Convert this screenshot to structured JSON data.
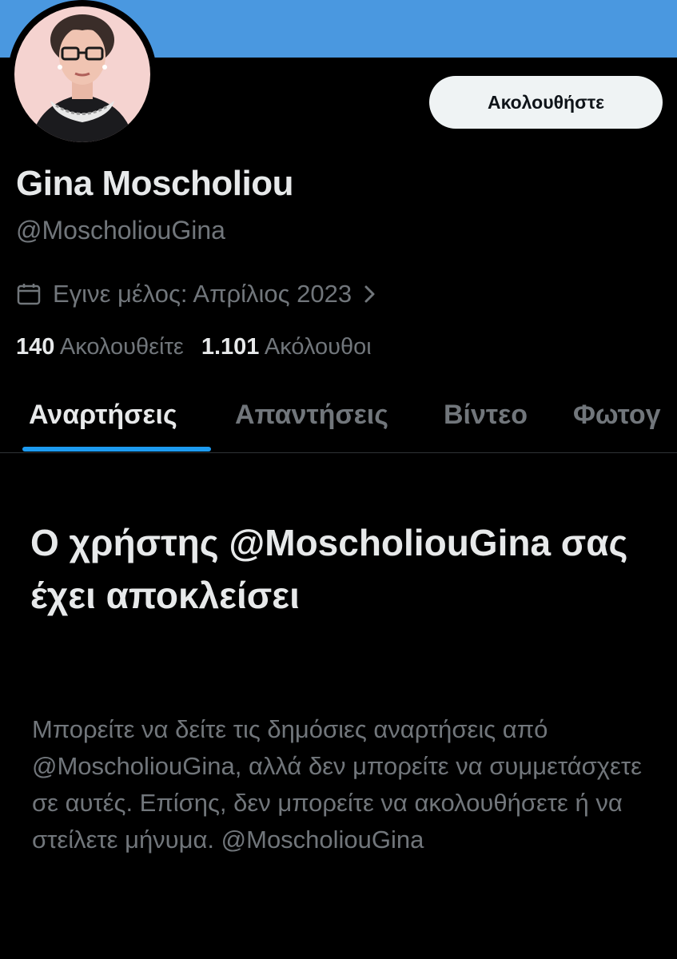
{
  "profile": {
    "display_name": "Gina Moscholiou",
    "handle": "@MoscholiouGina",
    "joined": "Εγινε μέλος: Απρίλιος 2023",
    "following_count": "140",
    "following_label": "Ακολουθείτε",
    "followers_count": "1.101",
    "followers_label": "Ακόλουθοι"
  },
  "actions": {
    "follow_label": "Ακολουθήστε"
  },
  "tabs": [
    {
      "label": "Αναρτήσεις",
      "active": true
    },
    {
      "label": "Απαντήσεις",
      "active": false
    },
    {
      "label": "Βίντεο",
      "active": false
    },
    {
      "label": "Φωτογ",
      "active": false
    }
  ],
  "blocked": {
    "title": "Ο χρήστης @MoscholiouGina σας έχει αποκλείσει",
    "description": "Μπορείτε να δείτε τις δημόσιες αναρτήσεις από @MoscholiouGina, αλλά δεν μπορείτε να συμμετάσχετε σε αυτές. Επίσης, δεν μπορείτε να ακολουθήσετε ή να στείλετε μήνυμα. @MoscholiouGina"
  },
  "colors": {
    "banner": "#4a98e0",
    "accent": "#1d9bf0",
    "background": "#000000",
    "text_primary": "#e7e9ea",
    "text_secondary": "#71767b"
  },
  "icons": {
    "calendar": "calendar-icon",
    "chevron": "chevron-right-icon"
  }
}
